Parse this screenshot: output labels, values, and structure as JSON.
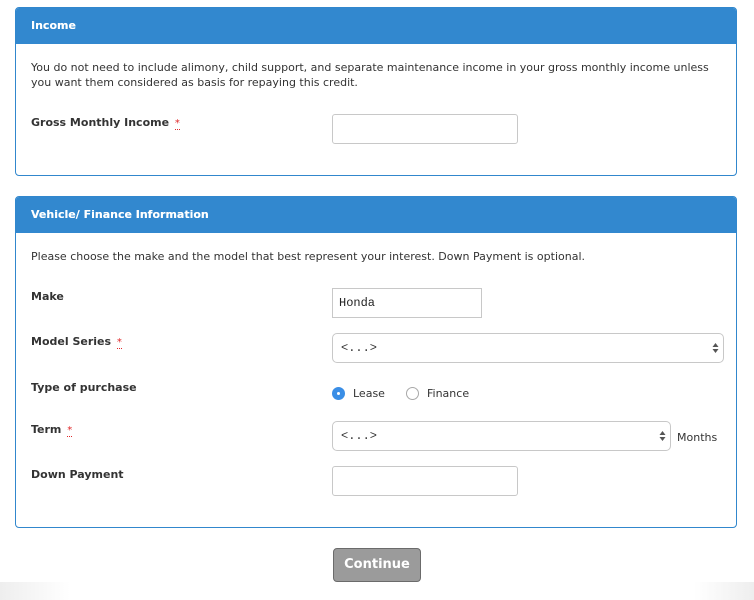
{
  "income": {
    "title": "Income",
    "intro": "You do not need to include alimony, child support, and separate maintenance income in your gross monthly income unless you want them considered as basis for repaying this credit.",
    "gross_monthly_income": {
      "label": "Gross Monthly Income",
      "required_mark": "*",
      "value": "",
      "placeholder": ""
    }
  },
  "vehicle": {
    "title": "Vehicle/ Finance Information",
    "intro": "Please choose the make and the model that best represent your interest. Down Payment is optional.",
    "make": {
      "label": "Make",
      "value": "Honda"
    },
    "model_series": {
      "label": "Model Series",
      "required_mark": "*",
      "selected": "<...>"
    },
    "type_of_purchase": {
      "label": "Type of purchase",
      "options": [
        {
          "label": "Lease",
          "checked": true
        },
        {
          "label": "Finance",
          "checked": false
        }
      ]
    },
    "term": {
      "label": "Term",
      "required_mark": "*",
      "selected": "<...>",
      "unit": "Months"
    },
    "down_payment": {
      "label": "Down Payment",
      "value": ""
    }
  },
  "actions": {
    "continue_label": "Continue"
  },
  "colors": {
    "header_blue": "#3288cf",
    "required_red": "#e0282a",
    "button_gray": "#9b9b9b"
  }
}
